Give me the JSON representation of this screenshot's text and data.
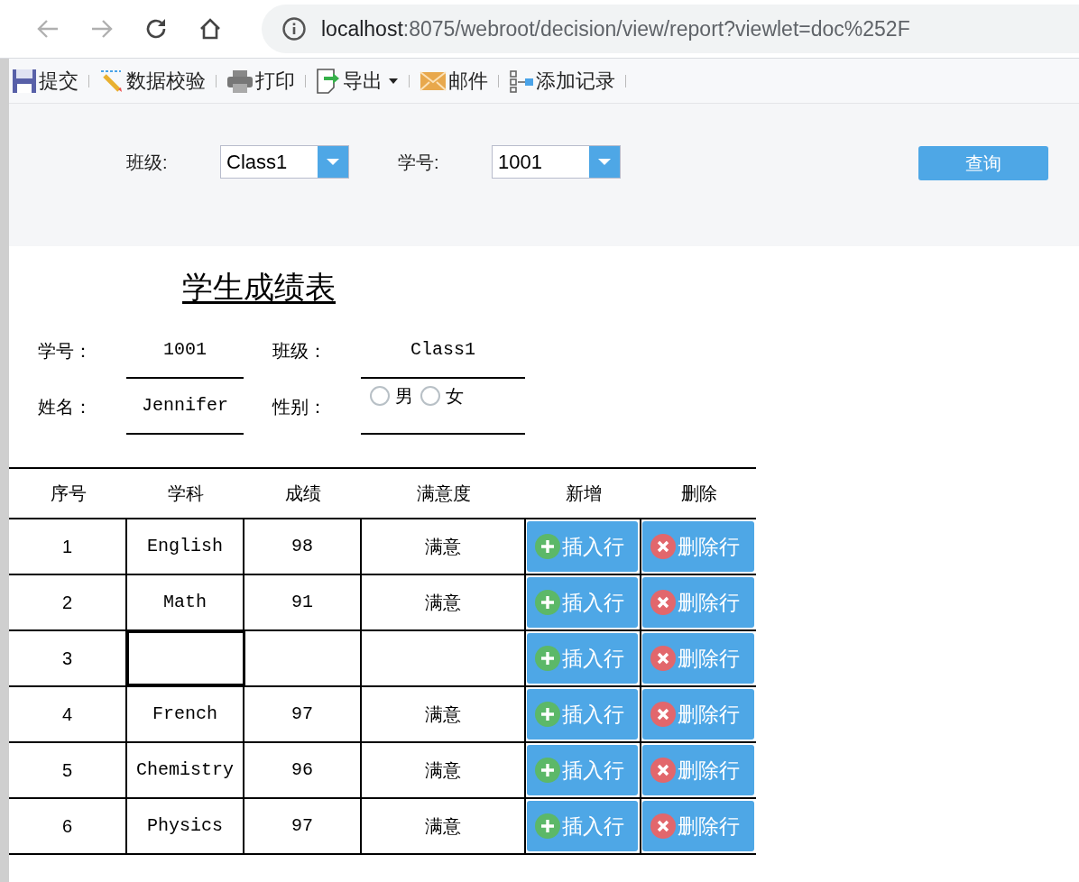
{
  "browser": {
    "url_host": "localhost",
    "url_rest": ":8075/webroot/decision/view/report?viewlet=doc%252F"
  },
  "toolbar": [
    {
      "kind": "save",
      "label": "提交"
    },
    {
      "kind": "validate",
      "label": "数据校验"
    },
    {
      "kind": "print",
      "label": "打印"
    },
    {
      "kind": "export",
      "label": "导出",
      "has_menu": true
    },
    {
      "kind": "mail",
      "label": "邮件"
    },
    {
      "kind": "add",
      "label": "添加记录"
    }
  ],
  "parameters": [
    {
      "label": "班级:",
      "value": "Class1"
    },
    {
      "label": "学号:",
      "value": "1001"
    }
  ],
  "query_button": "查询",
  "report": {
    "title": "学生成绩表",
    "info": [
      {
        "label": "学号：",
        "value": "1001"
      },
      {
        "label": "班级：",
        "value": "Class1"
      },
      {
        "label": "姓名：",
        "value": "Jennifer"
      },
      {
        "label": "性别：",
        "options": [
          {
            "label": "男",
            "checked": false
          },
          {
            "label": "女",
            "checked": false
          }
        ]
      }
    ],
    "columns": [
      "序号",
      "学科",
      "成绩",
      "满意度",
      "新增",
      "删除"
    ],
    "rows": [
      {
        "no": "1",
        "subject": "English",
        "score": "98",
        "satisfaction": "满意",
        "selected": false,
        "insert": "插入行",
        "delete": "删除行"
      },
      {
        "no": "2",
        "subject": "Math",
        "score": "91",
        "satisfaction": "满意",
        "selected": false,
        "insert": "插入行",
        "delete": "删除行"
      },
      {
        "no": "3",
        "selected": true,
        "insert": "插入行",
        "delete": "删除行"
      },
      {
        "no": "4",
        "subject": "French",
        "score": "97",
        "satisfaction": "满意",
        "selected": false,
        "insert": "插入行",
        "delete": "删除行"
      },
      {
        "no": "5",
        "subject": "Chemistry",
        "score": "96",
        "satisfaction": "满意",
        "selected": false,
        "insert": "插入行",
        "delete": "删除行"
      },
      {
        "no": "6",
        "subject": "Physics",
        "score": "97",
        "satisfaction": "满意",
        "selected": false,
        "insert": "插入行",
        "delete": "删除行"
      }
    ]
  }
}
